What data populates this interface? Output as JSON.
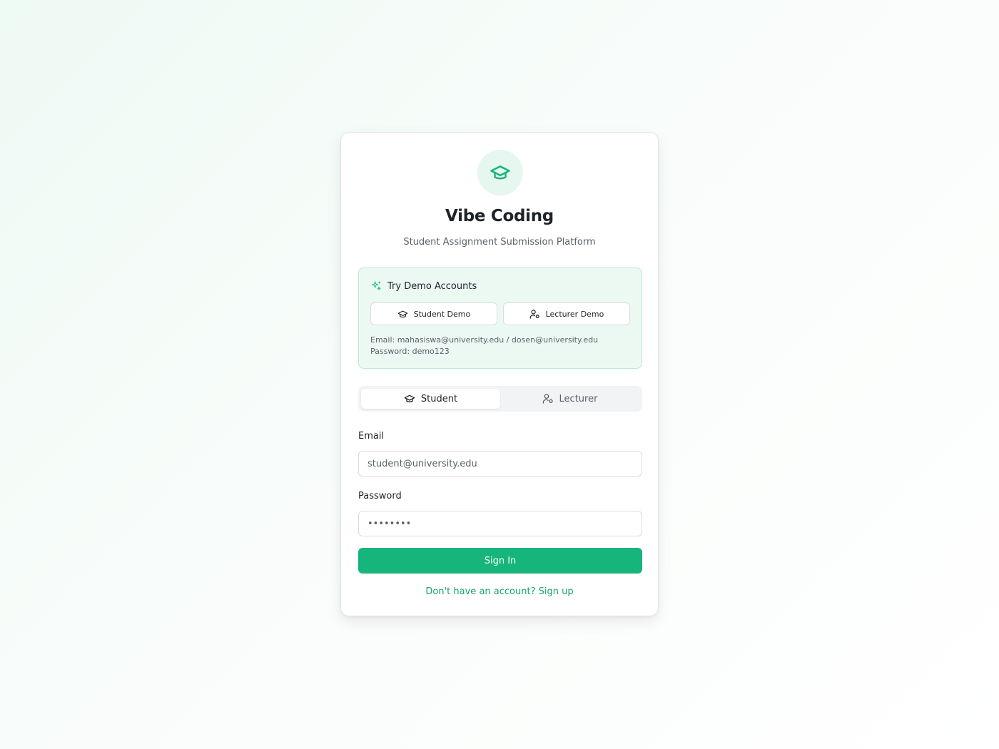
{
  "app": {
    "title": "Vibe Coding",
    "subtitle": "Student Assignment Submission Platform",
    "logo_icon": "graduation-cap-icon"
  },
  "demo": {
    "title": "Try Demo Accounts",
    "icon": "sparkles-icon",
    "student_button": "Student Demo",
    "lecturer_button": "Lecturer Demo",
    "email_info": "Email: mahasiswa@university.edu / dosen@university.edu",
    "password_info": "Password: demo123"
  },
  "tabs": {
    "student": "Student",
    "lecturer": "Lecturer",
    "active": "student"
  },
  "form": {
    "email_label": "Email",
    "email_value": "student@university.edu",
    "password_label": "Password",
    "password_value": "••••••••",
    "submit_label": "Sign In",
    "signup_link": "Don't have an account? Sign up"
  },
  "colors": {
    "accent": "#16b57c",
    "accent_light": "#e6f7ef",
    "demo_bg": "#ecf9f3"
  }
}
